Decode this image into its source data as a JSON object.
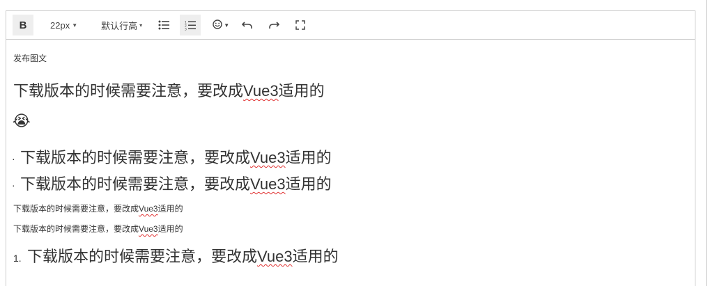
{
  "toolbar": {
    "bold_label": "B",
    "font_size_label": "22px",
    "line_height_label": "默认行高",
    "buttons": {
      "bulleted_list": "list-bulleted-icon",
      "numbered_list": "list-numbered-icon",
      "emoji": "emoji-smile-icon",
      "undo": "undo-icon",
      "redo": "redo-icon",
      "fullscreen": "fullscreen-icon"
    }
  },
  "content": {
    "heading": "发布图文",
    "line_large_prefix": "下载版本的时候需要注意，要改成",
    "line_large_misspelled": "Vue3",
    "line_large_suffix": "适用的",
    "emoji": "😭",
    "bullet_1_prefix": "下载版本的时候需要注意，要改成",
    "bullet_1_misspelled": "Vue3",
    "bullet_1_suffix": "适用的",
    "bullet_2_prefix": "下载版本的时候需要注意，要改成",
    "bullet_2_misspelled": "Vue3",
    "bullet_2_suffix": "适用的",
    "small_1_prefix": "下载版本的时候需要注意，要改成",
    "small_1_misspelled": "Vue3",
    "small_1_suffix": "适用的",
    "small_2_prefix": "下载版本的时候需要注意，要改成",
    "small_2_misspelled": "Vue3",
    "small_2_suffix": "适用的",
    "numbered_marker": "1.",
    "numbered_prefix": "下载版本的时候需要注意，要改成",
    "numbered_misspelled": "Vue3",
    "numbered_suffix": "适用的"
  },
  "colors": {
    "border": "#cccccc",
    "active_button_bg": "#eeeeee",
    "text": "#333333",
    "spellcheck": "#e03030"
  }
}
